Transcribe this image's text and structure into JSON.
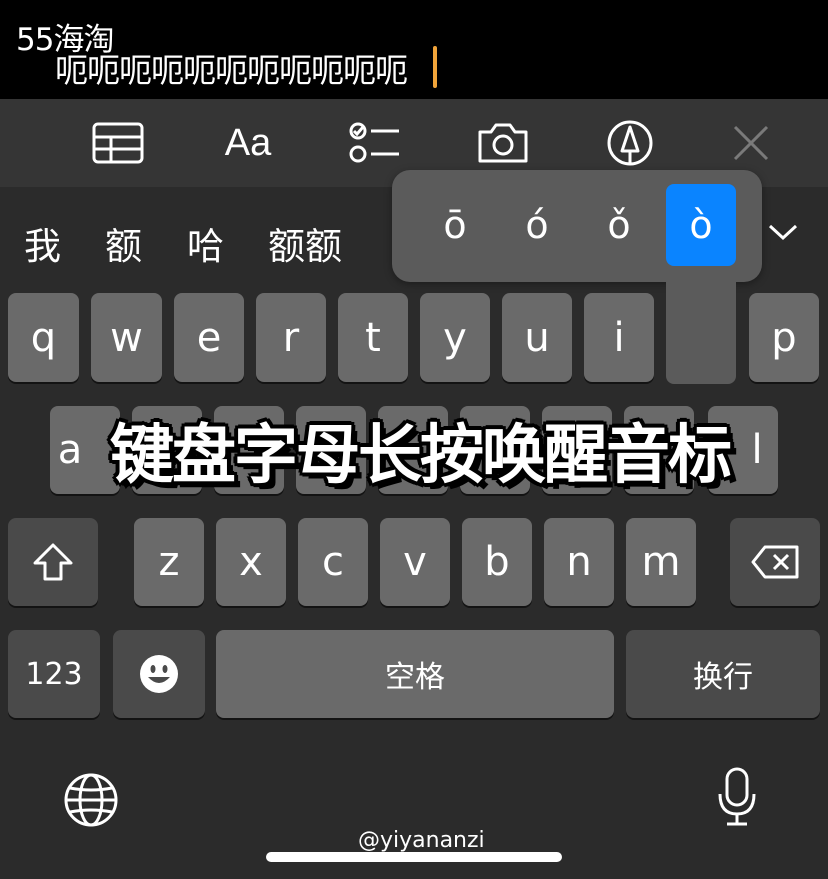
{
  "top": {
    "logo": "55海淘",
    "typed_text": "呃呃呃呃呃呃呃呃呃呃呃"
  },
  "toolbar": {
    "items": [
      {
        "name": "table",
        "icon": "table-icon"
      },
      {
        "name": "format",
        "label": "Aa",
        "icon": "text-format-icon"
      },
      {
        "name": "checklist",
        "icon": "checklist-icon"
      },
      {
        "name": "camera",
        "icon": "camera-icon"
      },
      {
        "name": "markup",
        "icon": "pen-circle-icon"
      },
      {
        "name": "close",
        "icon": "close-icon"
      }
    ]
  },
  "candidates": [
    "我",
    "额",
    "哈",
    "额额"
  ],
  "accent_popup": {
    "options": [
      "ō",
      "ó",
      "ǒ",
      "ò"
    ],
    "selected": "ò",
    "selected_color": "#0a84ff"
  },
  "keyboard": {
    "row1": [
      "q",
      "w",
      "e",
      "r",
      "t",
      "y",
      "u",
      "i",
      "p"
    ],
    "row2": [
      "a",
      "l"
    ],
    "row3": [
      "z",
      "x",
      "c",
      "v",
      "b",
      "n",
      "m"
    ],
    "numbers_label": "123",
    "space_label": "空格",
    "return_label": "换行"
  },
  "overlay_caption": "键盘字母长按唤醒音标",
  "watermark": "@yiyananzi",
  "colors": {
    "caret": "#f1a43a",
    "key": "#6a6a6a",
    "function_key": "#4a4a4a",
    "keyboard_bg": "#2b2b2b"
  }
}
